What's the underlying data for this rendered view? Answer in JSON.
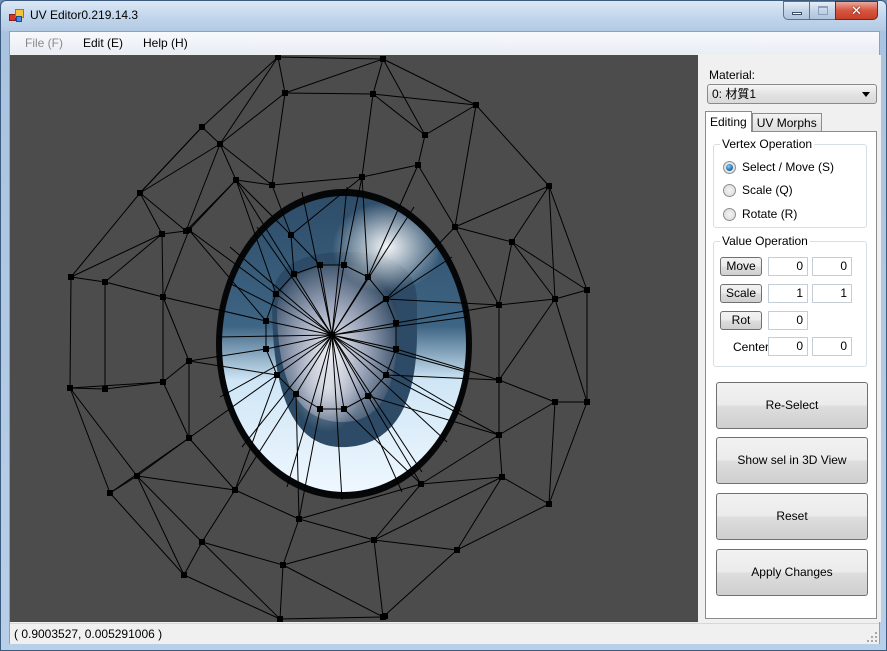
{
  "window": {
    "title": "UV Editor0.219.14.3",
    "controls": {
      "minimize": "minimize",
      "maximize": "maximize",
      "close": "✕"
    }
  },
  "menu": {
    "items": [
      {
        "label": "File (F)",
        "enabled": false
      },
      {
        "label": "Edit (E)",
        "enabled": true
      },
      {
        "label": "Help (H)",
        "enabled": true
      }
    ]
  },
  "sidebar": {
    "material_label": "Material:",
    "material_value": "0: 材質1",
    "tabs": [
      {
        "label": "Editing",
        "active": true
      },
      {
        "label": "UV Morphs",
        "active": false
      }
    ],
    "vertex_operation": {
      "title": "Vertex Operation",
      "options": [
        {
          "label": "Select / Move (S)",
          "checked": true
        },
        {
          "label": "Scale (Q)",
          "checked": false
        },
        {
          "label": "Rotate (R)",
          "checked": false
        }
      ]
    },
    "value_operation": {
      "title": "Value Operation",
      "move_label": "Move",
      "move_x": "0",
      "move_y": "0",
      "scale_label": "Scale",
      "scale_x": "1",
      "scale_y": "1",
      "rot_label": "Rot",
      "rot_value": "0",
      "center_label": "Center",
      "center_x": "0",
      "center_y": "0"
    },
    "buttons": {
      "reselect": "Re-Select",
      "show_sel": "Show sel in 3D View",
      "reset": "Reset",
      "apply": "Apply Changes"
    }
  },
  "canvas": {
    "background": "#4c4c4c",
    "texture": "eye-iris",
    "mesh_color": "#000000"
  },
  "status": {
    "coords": "( 0.9003527, 0.005291006 )"
  }
}
